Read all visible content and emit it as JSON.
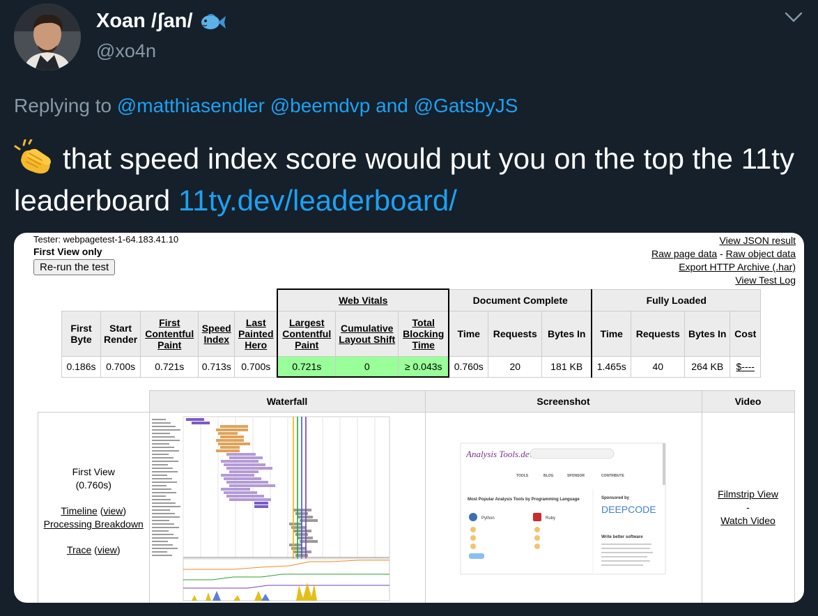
{
  "user": {
    "name": "Xoan /ʃan/",
    "handle": "@xo4n",
    "emoji_icon": "fish-icon"
  },
  "reply": {
    "prefix": "Replying to",
    "mention1": "@matthiasendler",
    "mention2": "@beemdvp",
    "and_word": "and",
    "mention3": "@GatsbyJS"
  },
  "tweet": {
    "emoji_icon": "clapping-hands-icon",
    "text": "that speed index score would put you on the top the 11ty leaderboard",
    "link": "11ty.dev/leaderboard/"
  },
  "wpt": {
    "tester": "Tester: webpagetest-1-64.183.41.10",
    "first_view_only": "First View only",
    "rerun": "Re-run the test",
    "links": {
      "json": "View JSON result",
      "raw_page": "Raw page data",
      "sep": "-",
      "raw_object": "Raw object data",
      "har": "Export HTTP Archive (.har)",
      "test_log": "View Test Log"
    },
    "groups": {
      "web_vitals": "Web Vitals",
      "doc_complete": "Document Complete",
      "fully_loaded": "Fully Loaded"
    },
    "headers": {
      "first_byte": "First Byte",
      "start_render": "Start Render",
      "fcp": "First Contentful Paint",
      "speed_index": "Speed Index",
      "last_painted_hero": "Last Painted Hero",
      "lcp": "Largest Contentful Paint",
      "cls": "Cumulative Layout Shift",
      "tbt": "Total Blocking Time",
      "dc_time": "Time",
      "dc_requests": "Requests",
      "dc_bytes": "Bytes In",
      "fl_time": "Time",
      "fl_requests": "Requests",
      "fl_bytes": "Bytes In",
      "cost": "Cost"
    },
    "values": {
      "first_byte": "0.186s",
      "start_render": "0.700s",
      "fcp": "0.721s",
      "speed_index": "0.713s",
      "last_painted_hero": "0.700s",
      "lcp": "0.721s",
      "cls": "0",
      "tbt": "≥ 0.043s",
      "dc_time": "0.760s",
      "dc_requests": "20",
      "dc_bytes": "181 KB",
      "fl_time": "1.465s",
      "fl_requests": "40",
      "fl_bytes": "264 KB",
      "cost": "$----"
    },
    "lower": {
      "waterfall": "Waterfall",
      "screenshot": "Screenshot",
      "video": "Video",
      "first_view": "First View",
      "first_view_time": "(0.760s)",
      "timeline": "Timeline",
      "view1": "view",
      "processing": "Processing Breakdown",
      "trace": "Trace",
      "view2": "view",
      "filmstrip": "Filmstrip View",
      "dash": "-",
      "watch_video": "Watch Video"
    },
    "screenshot": {
      "logo": "Analysis Tools.dev",
      "nav": [
        "TOOLS",
        "BLOG",
        "SPONSOR",
        "CONTRIBUTE"
      ],
      "heading": "Most Popular Analysis Tools by Programming Language",
      "lang1": "Python",
      "lang2": "Ruby",
      "sponsored": "Sponsored by",
      "sponsor_name": "DEEPCODE",
      "write_better": "Write better software"
    }
  },
  "colors": {
    "bg": "#15202b",
    "link": "#1da1f2",
    "muted": "#8899a6",
    "green_cell": "#99ff99"
  }
}
